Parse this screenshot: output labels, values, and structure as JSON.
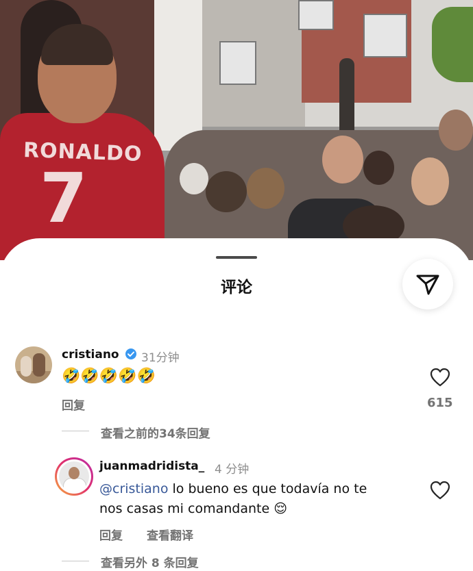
{
  "photo": {
    "jersey_name": "RONALDO",
    "jersey_number": "7"
  },
  "sheet": {
    "title": "评论"
  },
  "comments": [
    {
      "username": "cristiano",
      "verified": true,
      "time": "31分钟",
      "text": "🤣🤣🤣🤣🤣",
      "reply_label": "回复",
      "likes": "615",
      "view_previous": "查看之前的34条回复"
    },
    {
      "username": "juanmadridista_",
      "time": "4 分钟",
      "mention": "@cristiano",
      "text": "lo bueno es que todavía no te",
      "text_line2": "nos casas mi comandante 😌",
      "reply_label": "回复",
      "translate_label": "查看翻译",
      "view_more": "查看另外 8 条回复"
    }
  ],
  "colors": {
    "mention": "#385898",
    "secondary_text": "#737373",
    "verified": "#3897f0"
  },
  "icons": {
    "share": "paper-plane-icon",
    "like": "heart-outline-icon",
    "verified": "verified-badge-icon"
  }
}
